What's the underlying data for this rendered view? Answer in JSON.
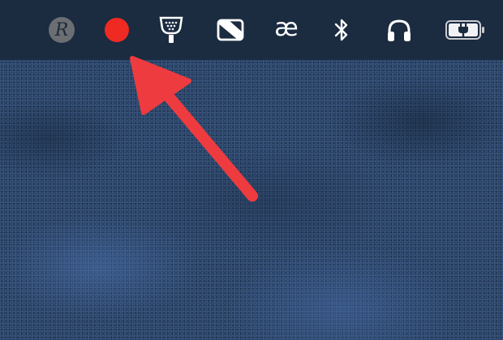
{
  "menubar": {
    "items": [
      {
        "icon": "retrobatch-r-icon"
      },
      {
        "icon": "record-dot-icon",
        "color": "#ee2a22"
      },
      {
        "icon": "shower-icon"
      },
      {
        "icon": "dock-window-icon"
      },
      {
        "icon": "ae-input-icon",
        "label": "æ"
      },
      {
        "icon": "bluetooth-icon"
      },
      {
        "icon": "headphones-icon"
      },
      {
        "icon": "battery-charging-icon"
      }
    ]
  },
  "annotation": {
    "icon": "pointer-arrow",
    "color": "#ee3b3f"
  },
  "colors": {
    "menubar": "#1b2b40",
    "desktop": "#2a4468"
  }
}
